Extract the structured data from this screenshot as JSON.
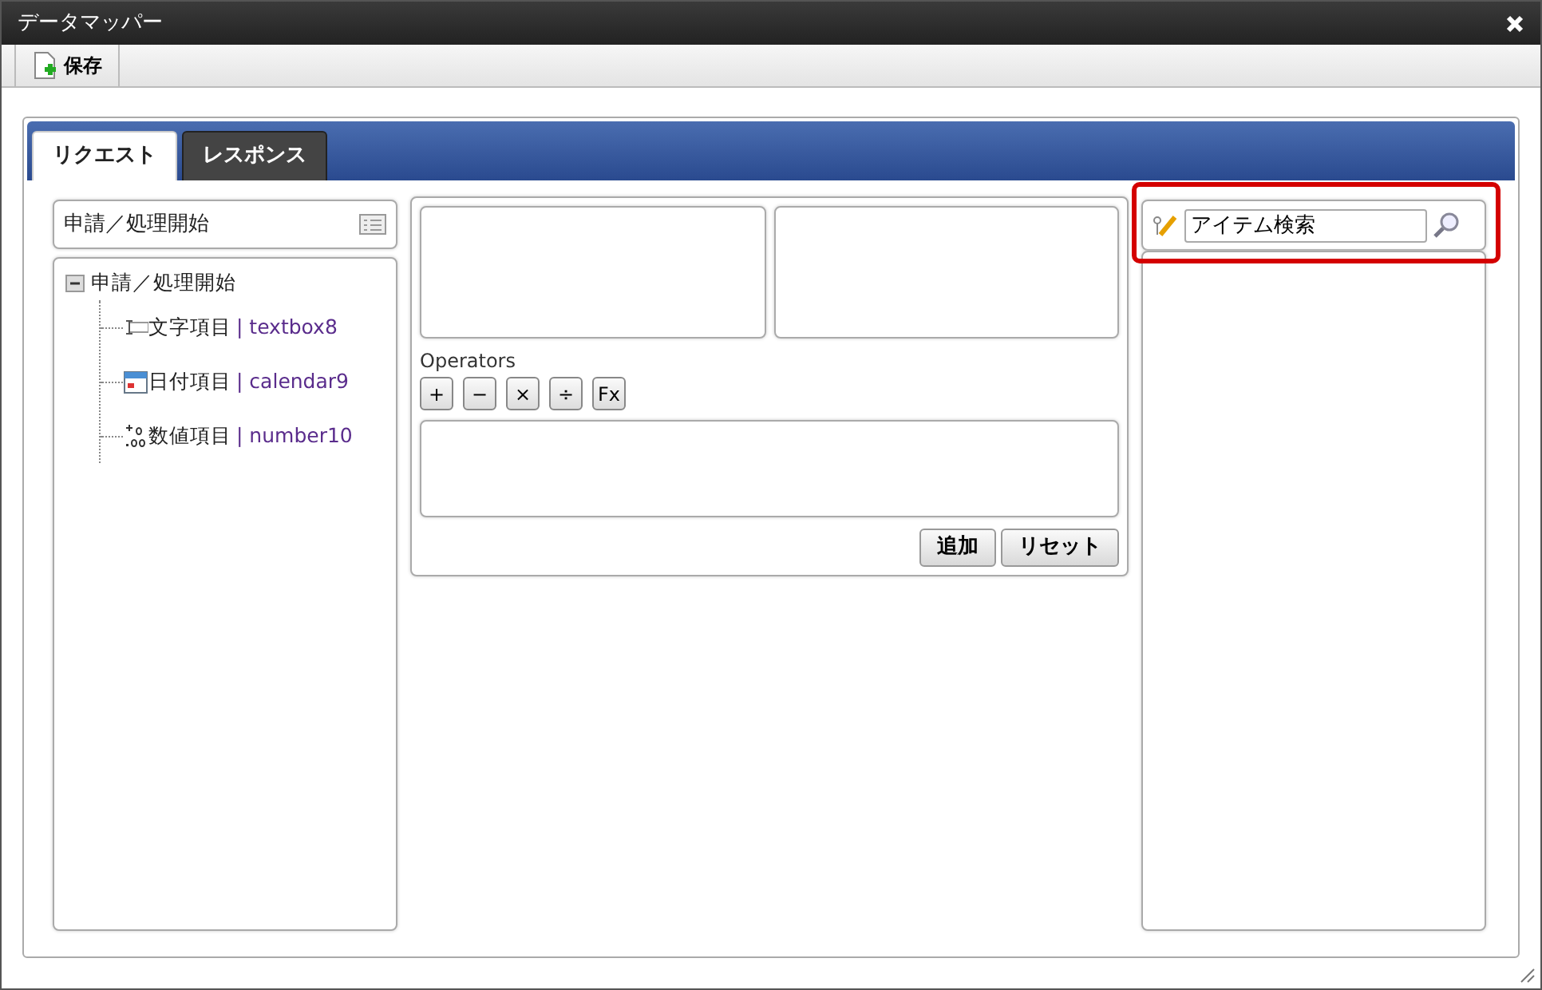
{
  "window": {
    "title": "データマッパー"
  },
  "toolbar": [
    {
      "label": "保存"
    }
  ],
  "tabs": [
    {
      "label": "リクエスト",
      "selected": true
    },
    {
      "label": "レスポンス",
      "selected": false
    }
  ],
  "source": {
    "selector": "申請／処理開始",
    "tree": [
      {
        "label": "申請／処理開始",
        "expanded": true,
        "children": [
          {
            "kind": "text",
            "label": "文字項目",
            "field": "| textbox8"
          },
          {
            "kind": "date",
            "label": "日付項目",
            "field": "| calendar9"
          },
          {
            "kind": "number",
            "label": "数値項目",
            "field": "| number10"
          }
        ]
      }
    ]
  },
  "editor": {
    "operators_label": "Operators",
    "operators": [
      "+",
      "−",
      "×",
      "÷",
      "Fx"
    ],
    "buttons": [
      "追加",
      "リセット"
    ]
  },
  "search": {
    "value": "アイテム検索",
    "highlighted": true
  }
}
